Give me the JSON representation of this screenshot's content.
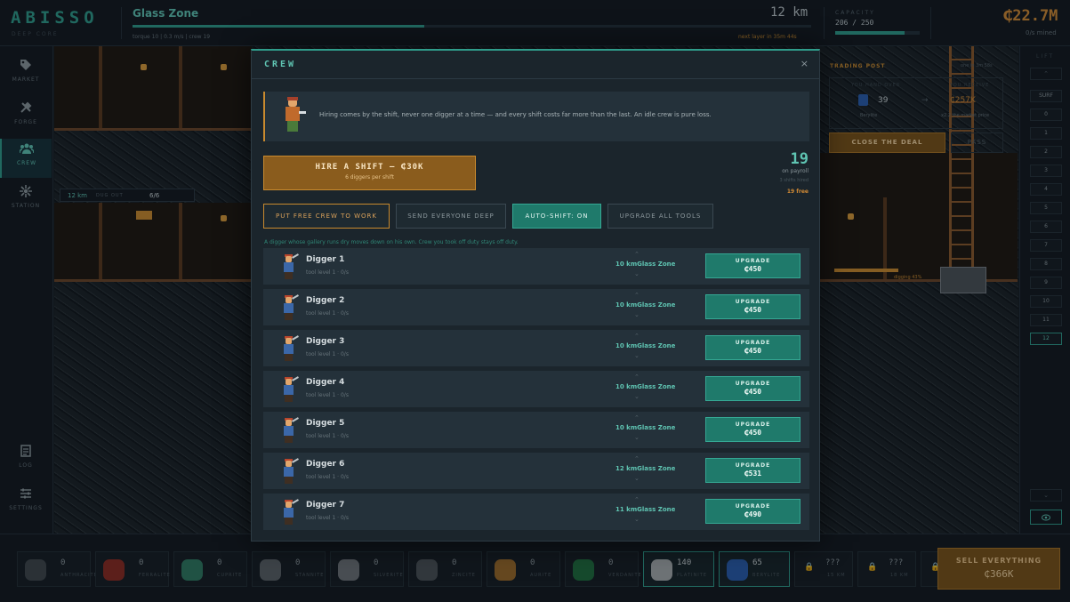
{
  "app": {
    "logo": "ABISSO",
    "logo_sub": "DEEP CORE"
  },
  "header": {
    "zone_title": "Glass Zone",
    "zone_stats": "torque 10 | 0.3 m/s | crew 19",
    "zone_progress": 0.43,
    "depth": "12 km",
    "next_layer": "next layer in 35m 44s",
    "capacity_label": "CAPACITY",
    "capacity_value": "206 / 250",
    "capacity_fraction": 0.82,
    "money": "₵22.7M",
    "money_sub": "0/s mined"
  },
  "sidebar": [
    {
      "label": "MARKET",
      "icon": "tag-icon"
    },
    {
      "label": "FORGE",
      "icon": "tools-icon"
    },
    {
      "label": "CREW",
      "icon": "crew-icon",
      "active": true
    },
    {
      "label": "STATION",
      "icon": "station-icon"
    },
    {
      "label": "LOG",
      "icon": "log-icon"
    },
    {
      "label": "SETTINGS",
      "icon": "settings-icon"
    }
  ],
  "mine": {
    "depth_tag": "12 km",
    "dug_out": "DUG OUT",
    "dug_count": "6/6",
    "digging": "digging 43%"
  },
  "trade": {
    "title": "TRADING POST",
    "timer": "one in 3m 58s",
    "hand_label": "YOU HAND OVER",
    "hand_count": "39",
    "hand_ore": "Berylite",
    "receive_label": "YOU RECEIVE",
    "receive_value": "₵257K",
    "receive_note": "x2.2 the market price",
    "close_label": "CLOSE THE DEAL",
    "pass_label": "PASS"
  },
  "lift": {
    "label": "LIFT",
    "levels": [
      "SURF",
      "0",
      "1",
      "2",
      "3",
      "4",
      "5",
      "6",
      "7",
      "8",
      "9",
      "10",
      "11",
      "12"
    ]
  },
  "modal": {
    "title": "CREW",
    "close": "×",
    "notice": "Hiring comes by the shift, never one digger at a time — and every shift costs far more than the last. An idle crew is pure loss.",
    "hire_label": "HIRE A SHIFT — ₵30K",
    "hire_sub": "6 diggers per shift",
    "payroll_count": "19",
    "payroll_label": "on payroll",
    "shifts_label": "3 shifts hired",
    "free_label": "19 free",
    "actions": {
      "free": "PUT FREE CREW TO WORK",
      "deep": "SEND EVERYONE DEEP",
      "auto": "AUTO-SHIFT: ON",
      "tools": "UPGRADE ALL TOOLS"
    },
    "hint": "A digger whose gallery runs dry moves down on his own. Crew you took off duty stays off duty.",
    "upgrade_label": "UPGRADE",
    "diggers": [
      {
        "name": "Digger 1",
        "sub": "tool level 1 · 0/s",
        "depth": "10 km",
        "zone": "Glass Zone",
        "cost": "₵450"
      },
      {
        "name": "Digger 2",
        "sub": "tool level 1 · 0/s",
        "depth": "10 km",
        "zone": "Glass Zone",
        "cost": "₵450"
      },
      {
        "name": "Digger 3",
        "sub": "tool level 1 · 0/s",
        "depth": "10 km",
        "zone": "Glass Zone",
        "cost": "₵450"
      },
      {
        "name": "Digger 4",
        "sub": "tool level 1 · 0/s",
        "depth": "10 km",
        "zone": "Glass Zone",
        "cost": "₵450"
      },
      {
        "name": "Digger 5",
        "sub": "tool level 1 · 0/s",
        "depth": "10 km",
        "zone": "Glass Zone",
        "cost": "₵450"
      },
      {
        "name": "Digger 6",
        "sub": "tool level 1 · 0/s",
        "depth": "12 km",
        "zone": "Glass Zone",
        "cost": "₵531"
      },
      {
        "name": "Digger 7",
        "sub": "tool level 1 · 0/s",
        "depth": "11 km",
        "zone": "Glass Zone",
        "cost": "₵490"
      }
    ]
  },
  "ores": [
    {
      "count": "0",
      "name": "ANTHRACITE",
      "color": "#3f474c"
    },
    {
      "count": "0",
      "name": "FERRALITE",
      "color": "#8a2b22"
    },
    {
      "count": "0",
      "name": "CUPRITE",
      "color": "#2f7a62"
    },
    {
      "count": "0",
      "name": "STANNITE",
      "color": "#5b6368"
    },
    {
      "count": "0",
      "name": "SILVERITE",
      "color": "#6e7478"
    },
    {
      "count": "0",
      "name": "ZINCITE",
      "color": "#4b5257"
    },
    {
      "count": "0",
      "name": "AURITE",
      "color": "#9a6a2a"
    },
    {
      "count": "0",
      "name": "VERDANITE",
      "color": "#1f6e3e"
    },
    {
      "count": "140",
      "name": "PLATINITE",
      "color": "#a7acae",
      "has": true
    },
    {
      "count": "65",
      "name": "BERYLITE",
      "color": "#2a5fae",
      "has": true
    },
    {
      "count": "???",
      "name": "15 KM",
      "locked": true
    },
    {
      "count": "???",
      "name": "18 KM",
      "locked": true
    },
    {
      "count": "???",
      "name": "",
      "locked": true
    }
  ],
  "sell": {
    "label": "SELL EVERYTHING",
    "value": "₵366K"
  }
}
